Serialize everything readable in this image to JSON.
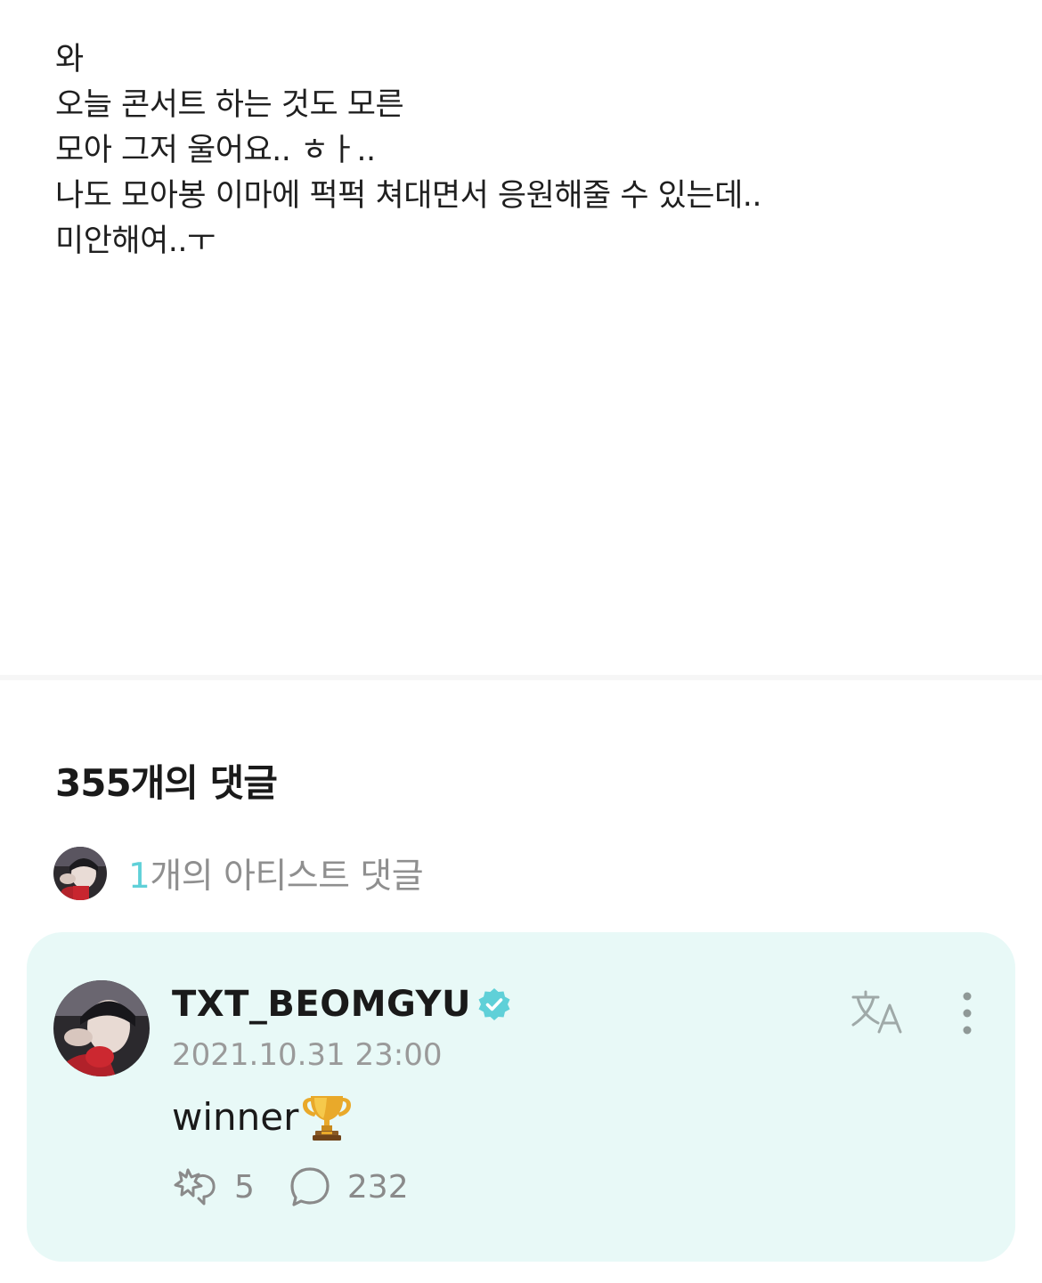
{
  "post": {
    "lines": [
      "와",
      "오늘 콘서트 하는 것도 모른",
      "모아 그저 울어요.. ㅎㅏ..",
      "나도 모아봉 이마에 퍽퍽 쳐대면서 응원해줄 수 있는데..",
      "미안해여..ㅜ"
    ]
  },
  "comments": {
    "title": "355개의 댓글",
    "artist_count_number": "1",
    "artist_count_label": "개의 아티스트 댓글"
  },
  "artist_comment": {
    "author": "TXT_BEOMGYU",
    "verified_icon": "verified-badge-icon",
    "timestamp": "2021.10.31 23:00",
    "text": "winner",
    "emoji": "trophy-icon",
    "like_count": "5",
    "reply_count": "232",
    "accent_color": "#5fd0d8",
    "card_color": "#e8f9f7"
  }
}
